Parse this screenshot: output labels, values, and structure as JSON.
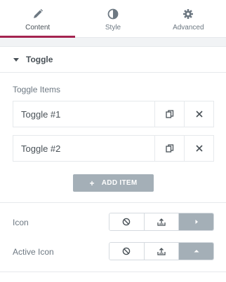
{
  "tabs": [
    {
      "label": "Content",
      "icon": "pencil-icon",
      "active": true
    },
    {
      "label": "Style",
      "icon": "half-circle-icon",
      "active": false
    },
    {
      "label": "Advanced",
      "icon": "gear-icon",
      "active": false
    }
  ],
  "section": {
    "title": "Toggle"
  },
  "repeater": {
    "label": "Toggle Items",
    "items": [
      {
        "title": "Toggle #1"
      },
      {
        "title": "Toggle #2"
      }
    ],
    "add_label": "ADD ITEM"
  },
  "icon_control": {
    "label": "Icon",
    "selected": "arrow-right-icon"
  },
  "active_icon_control": {
    "label": "Active Icon",
    "selected": "arrow-up-icon"
  },
  "colors": {
    "accent": "#a4234f",
    "active_choice": "#a4afb7"
  }
}
